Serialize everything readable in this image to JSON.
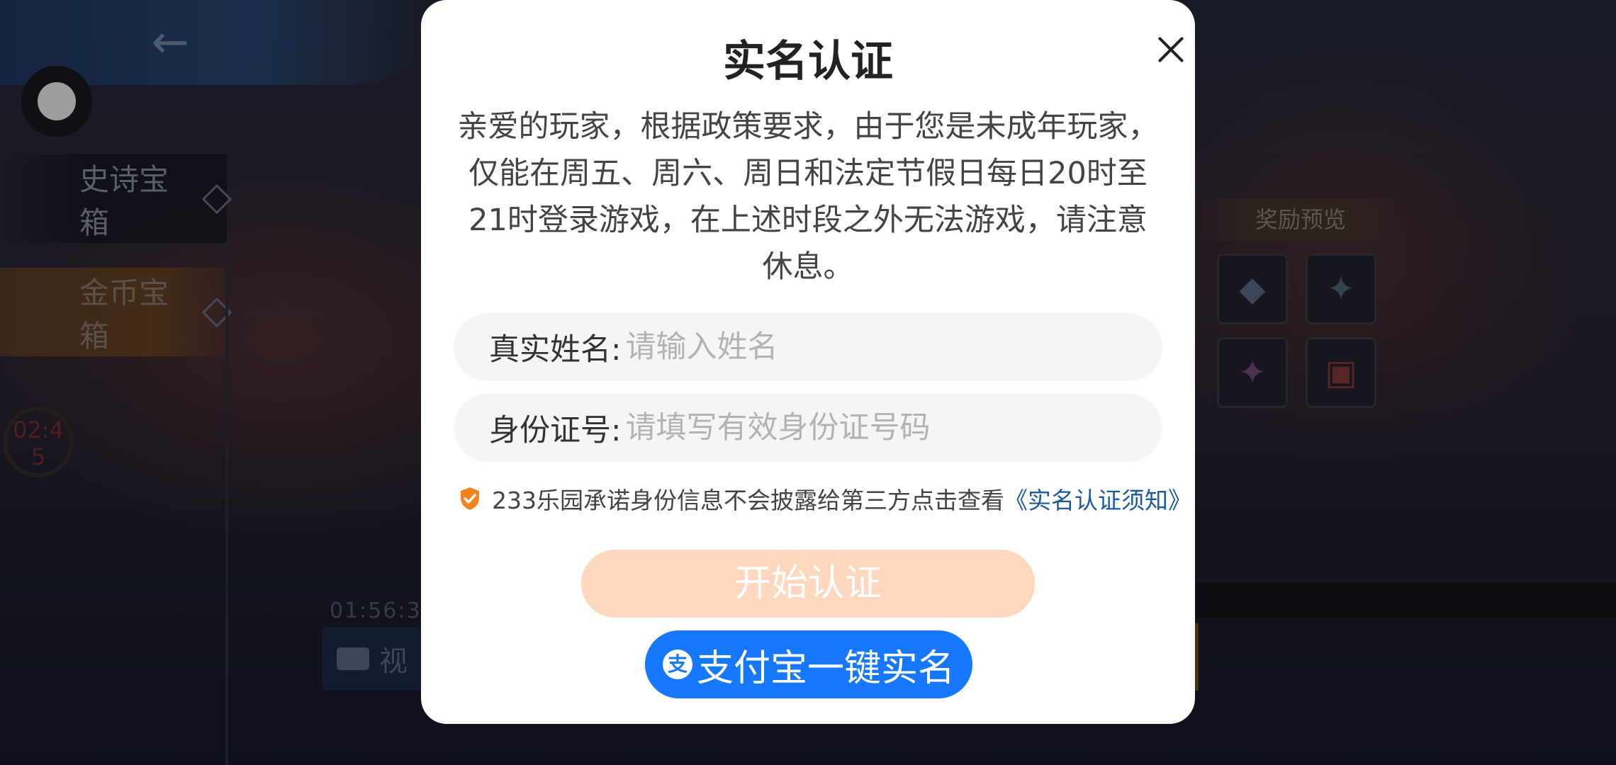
{
  "background": {
    "tabs": [
      {
        "label": "史诗宝箱"
      },
      {
        "label": "金币宝箱"
      }
    ],
    "countdown": "02:45",
    "bottom_time": "01:56:3",
    "video_label": "视",
    "reward_title": "奖励预览",
    "reward_icons": [
      "diamond-icon",
      "hero-shard-icon",
      "skin-shard-icon",
      "hero-trial-card-icon"
    ]
  },
  "dialog": {
    "title": "实名认证",
    "notice": "亲爱的玩家，根据政策要求，由于您是未成年玩家，仅能在周五、周六、周日和法定节假日每日20时至21时登录游戏，在上述时段之外无法游戏，请注意休息。",
    "name_field": {
      "label": "真实姓名:",
      "placeholder": "请输入姓名"
    },
    "id_field": {
      "label": "身份证号:",
      "placeholder": "请填写有效身份证号码"
    },
    "privacy_text": "233乐园承诺身份信息不会披露给第三方点击查看",
    "privacy_link": "《实名认证须知》",
    "start_button": "开始认证",
    "alipay_button": "支付宝一键实名",
    "alipay_logo_char": "支"
  },
  "colors": {
    "start_button_bg": "#ffd7bd",
    "alipay_blue": "#1677ff",
    "link_blue": "#1c5aa5",
    "shield_orange": "#f5821f"
  }
}
